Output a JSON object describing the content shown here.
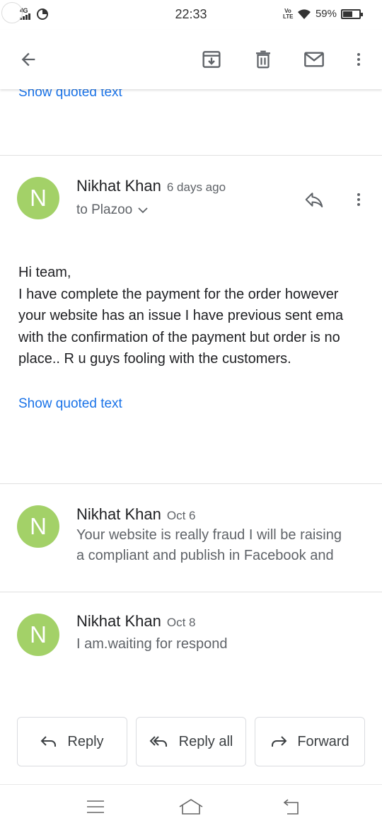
{
  "status_bar": {
    "network": "4G",
    "time": "22:33",
    "volte": "Vo LTE",
    "battery": "59%",
    "battery_level": 0.59,
    "icons": [
      "network-4g-icon",
      "hotspot-icon",
      "volte-icon",
      "wifi-icon",
      "battery-icon"
    ]
  },
  "toolbar": {
    "icons": [
      "back-arrow-icon",
      "archive-icon",
      "trash-icon",
      "mail-icon",
      "more-vert-icon"
    ]
  },
  "top_link": "Show quoted text",
  "message_expanded": {
    "avatar_letter": "N",
    "avatar_color": "#a3d168",
    "sender": "Nikhat Khan",
    "date": "6 days ago",
    "recipient": "to Plazoo",
    "body": [
      "Hi team,",
      "I have complete the payment for the order however",
      "your website has an issue I have previous sent ema",
      "with the confirmation of the payment but order is no",
      "place.. R u guys fooling with the customers."
    ],
    "show_quoted": "Show quoted text"
  },
  "thread_items": [
    {
      "avatar_letter": "N",
      "sender": "Nikhat Khan",
      "date": "Oct 6",
      "snippet": [
        "Your website is really fraud I will be raising",
        "a compliant and publish in Facebook and"
      ]
    },
    {
      "avatar_letter": "N",
      "sender": "Nikhat Khan",
      "date": "Oct 8",
      "snippet": [
        "I am.waiting for respond"
      ]
    }
  ],
  "actions": {
    "reply": "Reply",
    "reply_all": "Reply all",
    "forward": "Forward"
  },
  "colors": {
    "link": "#1a73e8",
    "avatar": "#a3d168",
    "icon": "#5f6368"
  }
}
